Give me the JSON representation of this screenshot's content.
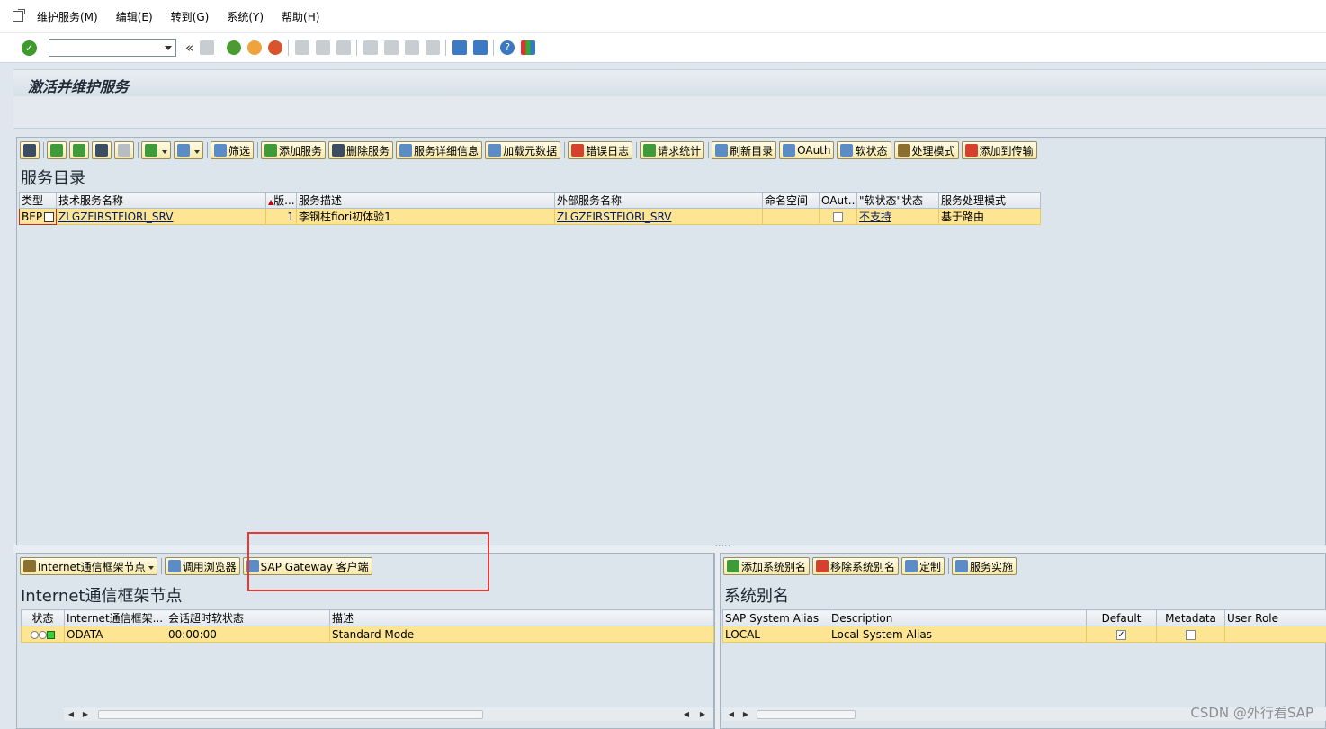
{
  "menubar": {
    "items": [
      "维护服务(M)",
      "编辑(E)",
      "转到(G)",
      "系统(Y)",
      "帮助(H)"
    ]
  },
  "systoolbar": {
    "command_field_value": "",
    "icons": [
      "ok-icon",
      "save-icon",
      "back-icon",
      "exit-icon",
      "cancel-icon",
      "print-icon",
      "find-icon",
      "find-next-icon",
      "first-page-icon",
      "prev-page-icon",
      "next-page-icon",
      "last-page-icon",
      "new-session-icon",
      "shortcut-icon",
      "help-icon",
      "customize-layout-icon"
    ]
  },
  "title": "激活并维护服务",
  "top_panel": {
    "toolbar": {
      "filter": "筛选",
      "add_service": "添加服务",
      "delete_service": "删除服务",
      "service_details": "服务详细信息",
      "load_metadata": "加载元数据",
      "error_log": "错误日志",
      "request_stats": "请求统计",
      "refresh_catalog": "刷新目录",
      "oauth": "OAuth",
      "soft_state": "软状态",
      "processing_mode": "处理模式",
      "add_to_transport": "添加到传输"
    },
    "section_title": "服务目录",
    "columns": [
      "类型",
      "技术服务名称",
      "版...",
      "服务描述",
      "外部服务名称",
      "命名空间",
      "OAut...",
      "\"软状态\"状态",
      "服务处理模式"
    ],
    "rows": [
      {
        "type": "BEP",
        "technical_name": "ZLGZFIRSTFIORI_SRV",
        "version": "1",
        "description": "李钢柱fiori初体验1",
        "external_name": "ZLGZFIRSTFIORI_SRV",
        "namespace": "",
        "oauth": false,
        "soft_state": "不支持",
        "processing_mode": "基于路由"
      }
    ]
  },
  "bottom_left": {
    "toolbar": {
      "icf_node": "Internet通信框架节点",
      "call_browser": "调用浏览器",
      "gateway_client": "SAP Gateway 客户端"
    },
    "section_title": "Internet通信框架节点",
    "columns": [
      "状态",
      "Internet通信框架...",
      "会话超时软状态",
      "描述"
    ],
    "rows": [
      {
        "icf_node": "ODATA",
        "timeout": "00:00:00",
        "description": "Standard Mode"
      }
    ]
  },
  "bottom_right": {
    "toolbar": {
      "add_alias": "添加系统别名",
      "remove_alias": "移除系统别名",
      "customize": "定制",
      "service_impl": "服务实施"
    },
    "section_title": "系统别名",
    "columns": [
      "SAP System Alias",
      "Description",
      "Default",
      "Metadata",
      "User Role"
    ],
    "rows": [
      {
        "alias": "LOCAL",
        "description": "Local System Alias",
        "default": true,
        "metadata": false,
        "user_role": ""
      }
    ]
  },
  "watermark": "CSDN @外行看SAP",
  "colors": {
    "selected_row": "#fde593",
    "panel_bg": "#dde5ec",
    "highlight_box": "#e53935"
  }
}
